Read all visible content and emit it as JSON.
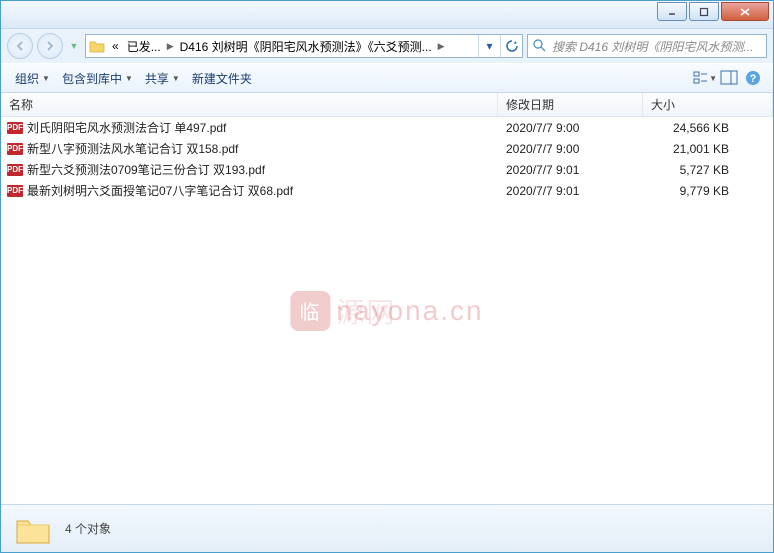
{
  "breadcrumbs": {
    "prefix": "«",
    "item1": "已发...",
    "item2": "D416 刘树明《阴阳宅风水预测法》《六爻预测...",
    "search_placeholder": "搜索 D416 刘树明《阴阳宅风水预测..."
  },
  "toolbar": {
    "organize": "组织",
    "include": "包含到库中",
    "share": "共享",
    "newfolder": "新建文件夹"
  },
  "columns": {
    "name": "名称",
    "date": "修改日期",
    "size": "大小"
  },
  "files": [
    {
      "name": "刘氏阴阳宅风水预测法合订 单497.pdf",
      "date": "2020/7/7 9:00",
      "size": "24,566 KB"
    },
    {
      "name": "新型八字预测法风水笔记合订 双158.pdf",
      "date": "2020/7/7 9:00",
      "size": "21,001 KB"
    },
    {
      "name": "新型六爻预测法0709笔记三份合订 双193.pdf",
      "date": "2020/7/7 9:01",
      "size": "5,727 KB"
    },
    {
      "name": "最新刘树明六爻面授笔记07八字笔记合订 双68.pdf",
      "date": "2020/7/7 9:01",
      "size": "9,779 KB"
    }
  ],
  "watermark": {
    "badge": "临",
    "text1": "nayona.cn",
    "text2": "源网"
  },
  "status": {
    "count": "4 个对象"
  },
  "icons": {
    "pdf": "PDF"
  }
}
